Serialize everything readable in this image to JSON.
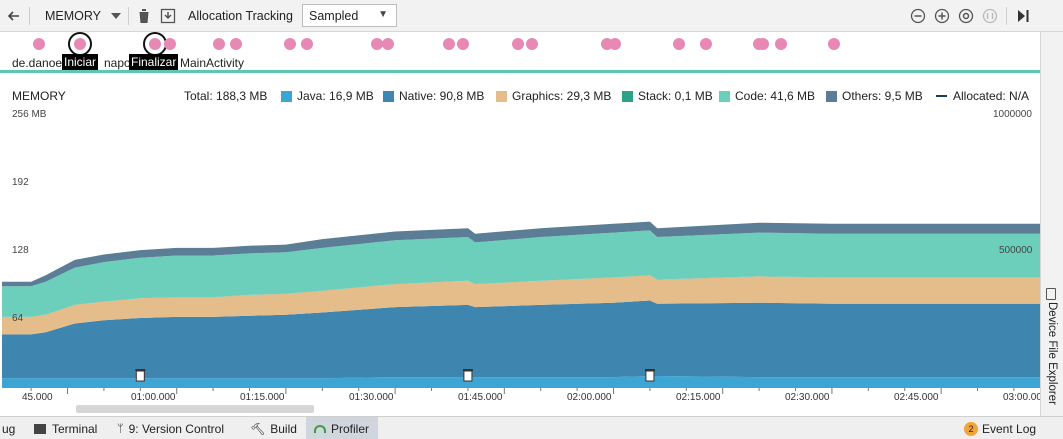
{
  "toolbar": {
    "back_icon": "arrow-left-icon",
    "profiler_label": "MEMORY",
    "allocation_label": "Allocation Tracking",
    "allocation_value": "Sampled"
  },
  "events": {
    "tooltip_start": "Iniciar",
    "tooltip_finish": "Finalizar",
    "activity_left": "de.danoel",
    "activity_mid": "napo",
    "activity_right": "MainActivity"
  },
  "legend": {
    "title": "MEMORY",
    "total": "Total: 188,3 MB",
    "items": [
      {
        "label": "Java: 16,9 MB",
        "color": "#3da5d4"
      },
      {
        "label": "Native: 90,8 MB",
        "color": "#3e86b0"
      },
      {
        "label": "Graphics: 29,3 MB",
        "color": "#e4bd8a"
      },
      {
        "label": "Stack: 0,1 MB",
        "color": "#2ea189"
      },
      {
        "label": "Code: 41,6 MB",
        "color": "#6bcfbc"
      },
      {
        "label": "Others: 9,5 MB",
        "color": "#5b7d95"
      }
    ],
    "allocated": "Allocated: N/A"
  },
  "axis": {
    "left_top": "256 MB",
    "left_192": "192",
    "left_128": "128",
    "left_64": "64",
    "right_top": "1000000",
    "right_mid": "500000"
  },
  "time_ticks": [
    "45.000",
    "01:00.000",
    "01:15.000",
    "01:30.000",
    "01:45.000",
    "02:00.000",
    "02:15.000",
    "02:30.000",
    "02:45.000",
    "03:00.000"
  ],
  "sidebar": {
    "device_explorer": "Device File Explorer"
  },
  "bottom": {
    "debug": "ug",
    "terminal": "Terminal",
    "version_control": "9: Version Control",
    "build": "Build",
    "profiler": "Profiler",
    "event_log": "Event Log",
    "event_count": "2"
  },
  "chart_data": {
    "type": "area",
    "stacked": true,
    "ylabel": "MB",
    "ylim": [
      0,
      256
    ],
    "y_ticks": [
      64,
      128,
      192,
      256
    ],
    "right_ticks": [
      500000,
      1000000
    ],
    "x": [
      36,
      40,
      42,
      46,
      50,
      55,
      60,
      65,
      70,
      75,
      80,
      90,
      100,
      101,
      110,
      120,
      125,
      126,
      140,
      150,
      180
    ],
    "series": [
      {
        "name": "Java",
        "values": [
          9,
          9,
          9,
          9,
          9,
          9,
          9,
          9,
          9,
          9,
          9,
          10,
          10,
          10,
          10,
          10,
          11,
          11,
          10,
          10,
          10
        ]
      },
      {
        "name": "Native",
        "values": [
          40,
          40,
          42,
          50,
          53,
          55,
          56,
          56,
          57,
          58,
          60,
          64,
          66,
          64,
          66,
          68,
          69,
          66,
          68,
          67,
          67
        ]
      },
      {
        "name": "Graphics",
        "values": [
          16,
          16,
          16,
          17,
          17,
          18,
          18,
          18,
          19,
          19,
          20,
          21,
          22,
          21,
          22,
          23,
          23,
          22,
          24,
          24,
          24
        ]
      },
      {
        "name": "Stack",
        "values": [
          0.1,
          0.1,
          0.1,
          0.1,
          0.1,
          0.1,
          0.1,
          0.1,
          0.1,
          0.1,
          0.1,
          0.1,
          0.1,
          0.1,
          0.1,
          0.1,
          0.1,
          0.1,
          0.1,
          0.1,
          0.1
        ]
      },
      {
        "name": "Code",
        "values": [
          28,
          28,
          30,
          34,
          36,
          37,
          38,
          38,
          38,
          38,
          39,
          40,
          40,
          38,
          40,
          41,
          41,
          39,
          40,
          40,
          40
        ]
      },
      {
        "name": "Others",
        "values": [
          4,
          4,
          6,
          7,
          7,
          7,
          7,
          7,
          7,
          7,
          8,
          8,
          8,
          8,
          8,
          8,
          8,
          8,
          9,
          9,
          9
        ]
      }
    ],
    "gc_events_x": [
      55,
      100,
      125
    ]
  }
}
